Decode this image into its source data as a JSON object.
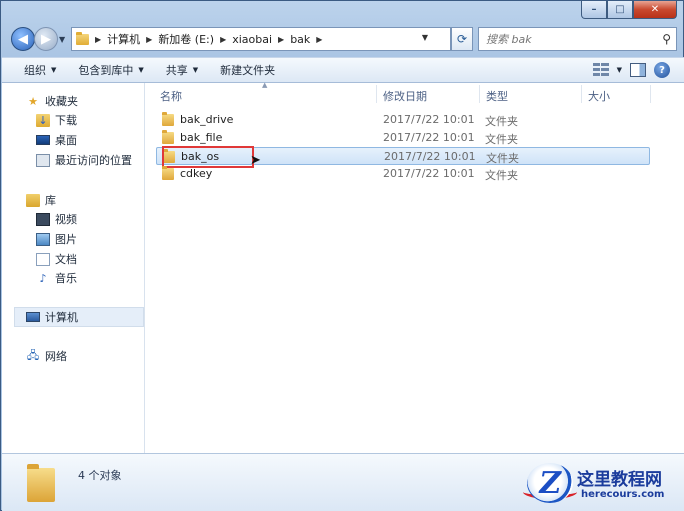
{
  "window": {
    "caption_min": "–",
    "caption_max": "□",
    "caption_close": "✕"
  },
  "address": {
    "breadcrumbs": [
      "计算机",
      "新加卷 (E:)",
      "xiaobai",
      "bak"
    ],
    "search_placeholder": "搜索 bak"
  },
  "toolbar": {
    "items": [
      "组织",
      "包含到库中",
      "共享",
      "新建文件夹"
    ]
  },
  "navpane": {
    "favorites": {
      "label": "收藏夹",
      "items": [
        "下载",
        "桌面",
        "最近访问的位置"
      ]
    },
    "libraries": {
      "label": "库",
      "items": [
        "视频",
        "图片",
        "文档",
        "音乐"
      ]
    },
    "computer": "计算机",
    "network": "网络"
  },
  "columns": {
    "name": "名称",
    "modified": "修改日期",
    "type": "类型",
    "size": "大小"
  },
  "files": [
    {
      "name": "bak_drive",
      "modified": "2017/7/22 10:01",
      "type": "文件夹",
      "selected": false
    },
    {
      "name": "bak_file",
      "modified": "2017/7/22 10:01",
      "type": "文件夹",
      "selected": false
    },
    {
      "name": "bak_os",
      "modified": "2017/7/22 10:01",
      "type": "文件夹",
      "selected": true
    },
    {
      "name": "cdkey",
      "modified": "2017/7/22 10:01",
      "type": "文件夹",
      "selected": false
    }
  ],
  "details": {
    "count": "4 个对象"
  },
  "watermark": {
    "title": "这里教程网",
    "url": "herecours.com",
    "logo_letter": "Z"
  },
  "colors": {
    "selection": "#cfe3f8",
    "highlight_box": "#e03838",
    "folder": "#dfa83a"
  }
}
